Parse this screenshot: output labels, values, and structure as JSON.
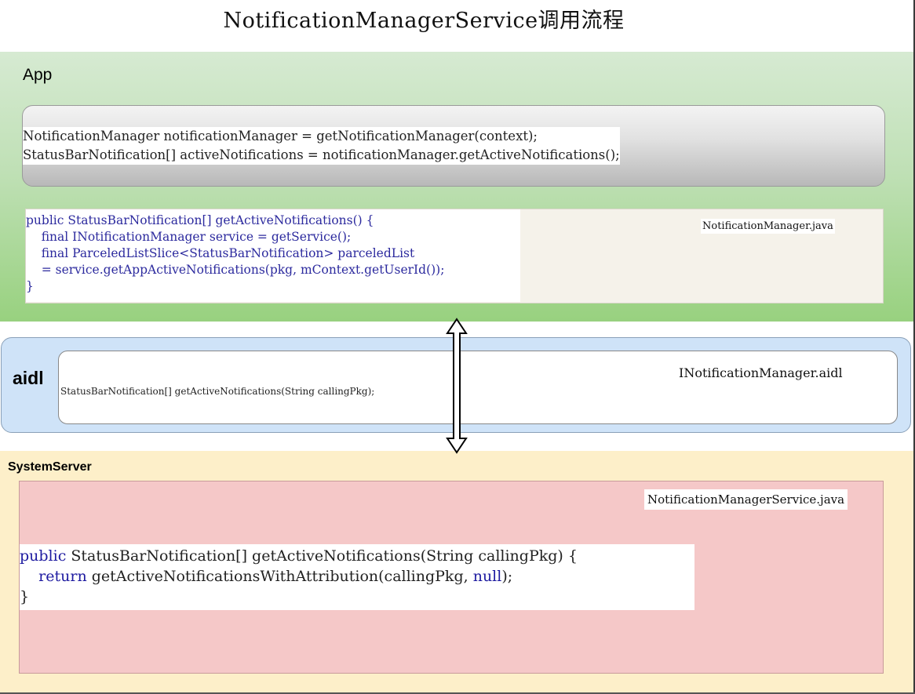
{
  "title": "NotificationManagerService调用流程",
  "app": {
    "label": "App",
    "call_code": [
      "NotificationManager notificationManager = getNotificationManager(context);",
      "StatusBarNotification[] activeNotifications = notificationManager.getActiveNotifications();"
    ],
    "method_code": [
      "public StatusBarNotification[] getActiveNotifications() {",
      "    final INotificationManager service = getService();",
      "    final ParceledListSlice<StatusBarNotification> parceledList",
      "    = service.getAppActiveNotifications(pkg, mContext.getUserId());",
      "}"
    ],
    "file": "NotificationManager.java"
  },
  "aidl": {
    "label": "aidl",
    "code": "StatusBarNotification[] getActiveNotifications(String callingPkg);",
    "file": "INotificationManager.aidl"
  },
  "system_server": {
    "label": "SystemServer",
    "file": "NotificationManagerService.java",
    "code": {
      "line1_kw": "public",
      "line1_rest": " StatusBarNotification[] getActiveNotifications(String callingPkg) {",
      "line2_kw": "return",
      "line2_mid": " getActiveNotificationsWithAttribution(callingPkg, ",
      "line2_null": "null",
      "line2_end": ");",
      "line3": "}"
    }
  },
  "colors": {
    "app_layer": "#a6d58c",
    "aidl_layer": "#cfe3f8",
    "system_layer": "#fdefc9",
    "service_box": "#f5c8c8",
    "keyword": "#1d1aa0"
  }
}
